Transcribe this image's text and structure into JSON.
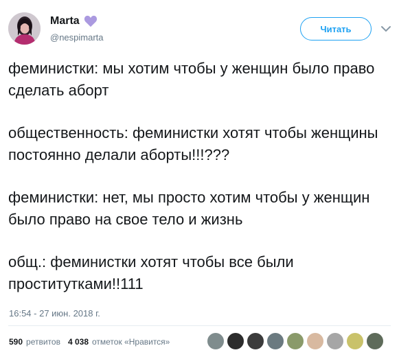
{
  "user": {
    "display_name": "Marta",
    "handle": "@nespimarta",
    "avatar_icon": "profile-photo",
    "badge_icon": "purple-heart-icon"
  },
  "follow_button": {
    "label": "Читать"
  },
  "menu": {
    "icon": "chevron-down-icon"
  },
  "tweet": {
    "paragraphs": [
      "феминистки: мы хотим чтобы у женщин было право сделать аборт",
      "общественность: феминистки хотят чтобы женщины постоянно делали аборты!!!???",
      "феминистки: нет, мы просто хотим чтобы у женщин было право на свое тело и жизнь",
      "общ.: феминистки хотят чтобы все были проститутками!!111"
    ],
    "timestamp": "16:54 - 27 июн. 2018 г."
  },
  "stats": {
    "retweets_count": "590",
    "retweets_label": "ретвитов",
    "likes_count": "4 038",
    "likes_label": "отметок «Нравится»"
  },
  "colors": {
    "accent": "#1da1f2",
    "heart": "#ab9ae0",
    "text": "#14171a",
    "muted": "#657786"
  },
  "likers": [
    "liker-avatar-1",
    "liker-avatar-2",
    "liker-avatar-3",
    "liker-avatar-4",
    "liker-avatar-5",
    "liker-avatar-6",
    "liker-avatar-7",
    "liker-avatar-8",
    "liker-avatar-9"
  ]
}
